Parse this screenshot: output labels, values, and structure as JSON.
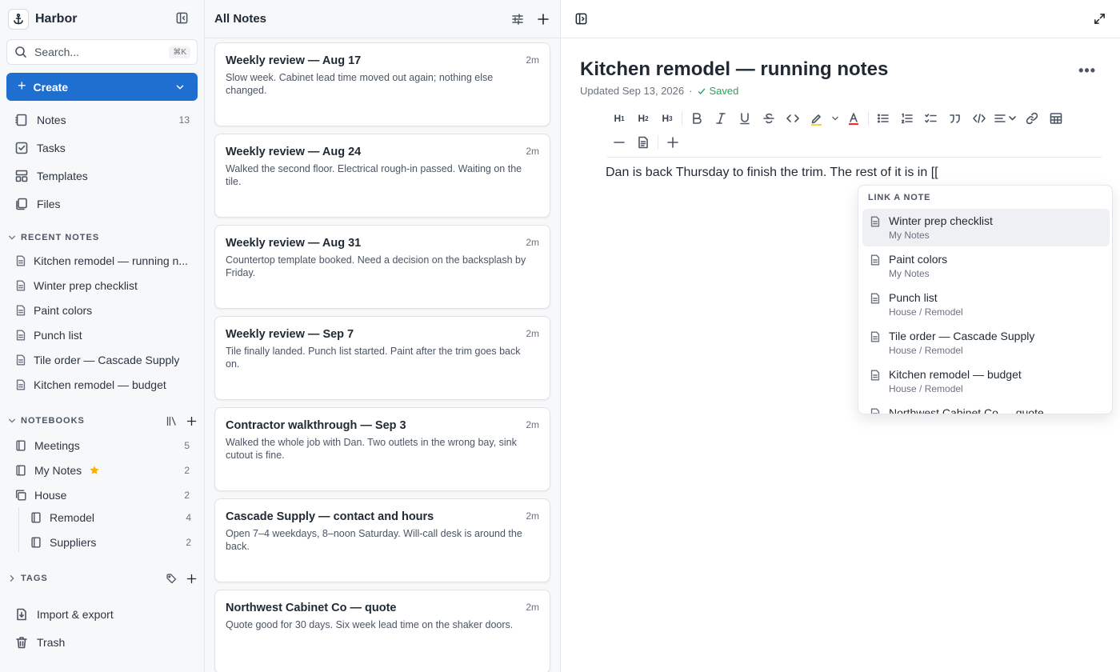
{
  "app": {
    "name": "Harbor"
  },
  "sidebar": {
    "search": {
      "placeholder": "Search...",
      "shortcut": "⌘K"
    },
    "create_label": "Create",
    "nav": [
      {
        "label": "Notes",
        "count": "13"
      },
      {
        "label": "Tasks"
      },
      {
        "label": "Templates"
      },
      {
        "label": "Files"
      }
    ],
    "recent_heading": "RECENT NOTES",
    "recent": [
      "Kitchen remodel — running n...",
      "Winter prep checklist",
      "Paint colors",
      "Punch list",
      "Tile order — Cascade Supply",
      "Kitchen remodel — budget"
    ],
    "notebooks_heading": "NOTEBOOKS",
    "notebooks": [
      {
        "label": "Meetings",
        "count": "5"
      },
      {
        "label": "My Notes",
        "count": "2",
        "starred": true
      },
      {
        "label": "House",
        "count": "2"
      },
      {
        "label": "Remodel",
        "count": "4"
      },
      {
        "label": "Suppliers",
        "count": "2"
      }
    ],
    "tags_heading": "TAGS",
    "footer": [
      {
        "label": "Import & export"
      },
      {
        "label": "Trash"
      }
    ]
  },
  "list": {
    "title": "All Notes",
    "notes": [
      {
        "title": "Weekly review — Aug 17",
        "time": "2m",
        "snippet": "Slow week. Cabinet lead time moved out again; nothing else changed."
      },
      {
        "title": "Weekly review — Aug 24",
        "time": "2m",
        "snippet": "Walked the second floor. Electrical rough-in passed. Waiting on the tile."
      },
      {
        "title": "Weekly review — Aug 31",
        "time": "2m",
        "snippet": "Countertop template booked. Need a decision on the backsplash by Friday."
      },
      {
        "title": "Weekly review — Sep 7",
        "time": "2m",
        "snippet": "Tile finally landed. Punch list started. Paint after the trim goes back on."
      },
      {
        "title": "Contractor walkthrough — Sep 3",
        "time": "2m",
        "snippet": "Walked the whole job with Dan. Two outlets in the wrong bay, sink cutout is fine."
      },
      {
        "title": "Cascade Supply — contact and hours",
        "time": "2m",
        "snippet": "Open 7–4 weekdays, 8–noon Saturday. Will-call desk is around the back."
      },
      {
        "title": "Northwest Cabinet Co — quote",
        "time": "2m",
        "snippet": "Quote good for 30 days. Six week lead time on the shaker doors."
      }
    ]
  },
  "editor": {
    "title": "Kitchen remodel — running notes",
    "updated": "Updated Sep 13, 2026",
    "dot": "·",
    "saved": "Saved",
    "body": "Dan is back Thursday to finish the trim. The rest of it is in [["
  },
  "link_popup": {
    "heading": "LINK A NOTE",
    "items": [
      {
        "title": "Winter prep checklist",
        "path": "My Notes"
      },
      {
        "title": "Paint colors",
        "path": "My Notes"
      },
      {
        "title": "Punch list",
        "path": "House / Remodel"
      },
      {
        "title": "Tile order — Cascade Supply",
        "path": "House / Remodel"
      },
      {
        "title": "Kitchen remodel — budget",
        "path": "House / Remodel"
      },
      {
        "title": "Northwest Cabinet Co — quote",
        "path": ""
      }
    ]
  },
  "colors": {
    "accent": "#1f6fd1",
    "saved": "#2e9e5b",
    "star": "#f5b100",
    "highlight_bar": "#f2d24b"
  }
}
